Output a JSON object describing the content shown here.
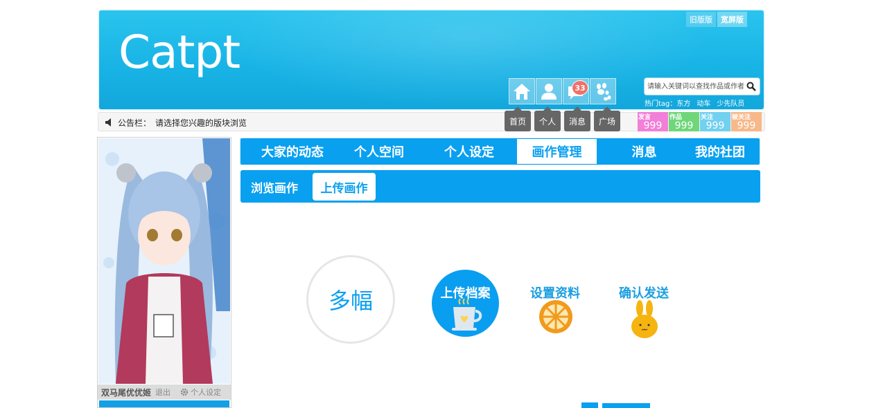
{
  "header": {
    "logo": "Catpt",
    "version_switch": [
      "旧版版",
      "宽屏版"
    ],
    "tiles": [
      {
        "icon": "home-icon"
      },
      {
        "icon": "user-icon"
      },
      {
        "icon": "message-icon",
        "badge": "33"
      },
      {
        "icon": "paw-icon"
      }
    ],
    "search": {
      "placeholder": "请输入关键词以查找作品或作者"
    },
    "hot_tags": {
      "label": "热门tag：",
      "tags": [
        "东方",
        "动车",
        "少先队员"
      ]
    }
  },
  "notice": {
    "label": "公告栏：",
    "text": "请选择您兴趣的版块浏览"
  },
  "quick_nav": [
    "首页",
    "个人",
    "消息",
    "广场"
  ],
  "stats": [
    {
      "label": "发言",
      "value": "999",
      "color": "#f27fd8"
    },
    {
      "label": "作品",
      "value": "999",
      "color": "#6fd77a"
    },
    {
      "label": "关注",
      "value": "999",
      "color": "#72d0f0"
    },
    {
      "label": "被关注",
      "value": "999",
      "color": "#f8b88a"
    }
  ],
  "profile": {
    "username": "双马尾优优姬",
    "logout": "退出",
    "settings": "个人设定"
  },
  "main_nav": {
    "items": [
      "大家的动态",
      "个人空间",
      "个人设定",
      "画作管理",
      "消息",
      "我的社团"
    ],
    "active": "画作管理"
  },
  "sub_nav": {
    "items": [
      "浏览画作",
      "上传画作"
    ],
    "active": "上传画作"
  },
  "upload": {
    "mode": "多幅",
    "steps": [
      "上传档案",
      "设置资料",
      "确认发送"
    ]
  },
  "colors": {
    "brand_blue": "#09a0f0",
    "banner": "#19b4e6"
  }
}
